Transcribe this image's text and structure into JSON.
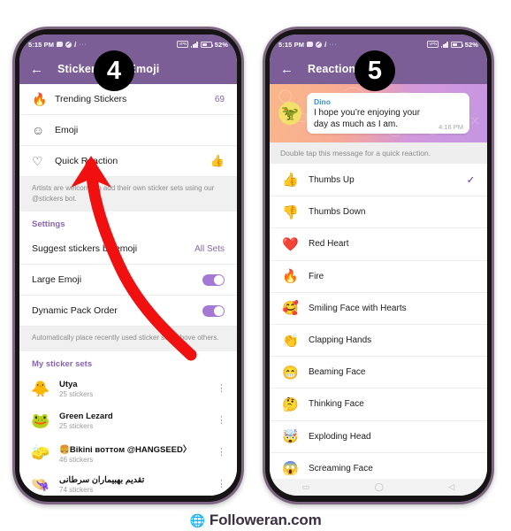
{
  "footer": {
    "site": "Followeran.com",
    "globe_icon": "globe-icon"
  },
  "phone_left": {
    "status_bar": {
      "time": "5:15 PM",
      "icons": [
        "message-bubble-icon",
        "mute-icon",
        "info-icon",
        "more-ellipsis-icon"
      ],
      "ellipsis": "···",
      "vpn_label": "VPN",
      "signal_icon": "signal-bars-icon",
      "battery_icon": "battery-icon",
      "battery_percent": "52%"
    },
    "app_bar": {
      "back_icon": "back-arrow-icon",
      "title": "Stickers and Emoji"
    },
    "step_badge": "4",
    "rows": [
      {
        "icon": "fire-icon",
        "label": "Trending Stickers",
        "value": "69"
      },
      {
        "icon": "smiley-icon",
        "label": "Emoji",
        "value": ""
      },
      {
        "icon": "heart-outline-icon",
        "label": "Quick Reaction",
        "emoji": "👍"
      }
    ],
    "artists_note": "Artists are welcome to add their own sticker sets using our @stickers bot.",
    "artists_note_link": "@stickers",
    "settings_header": "Settings",
    "settings_rows": [
      {
        "label": "Suggest stickers by emoji",
        "value": "All Sets",
        "type": "value"
      },
      {
        "label": "Large Emoji",
        "value": "on",
        "type": "toggle"
      },
      {
        "label": "Dynamic Pack Order",
        "value": "on",
        "type": "toggle"
      }
    ],
    "dynamic_note": "Automatically place recently used sticker sets above others.",
    "my_sets_header": "My sticker sets",
    "sticker_sets": [
      {
        "thumb": "🐥",
        "name": "Utya",
        "count": "25 stickers",
        "rtl": false
      },
      {
        "thumb": "🐸",
        "name": "Green Lezard",
        "count": "25 stickers",
        "rtl": false
      },
      {
        "thumb": "🧽",
        "name": "🍔Bikini вoттoм @HANGSEED〉",
        "count": "46 stickers",
        "rtl": false
      },
      {
        "thumb": "👒",
        "name": "تقدیم بهبیماران سرطانی",
        "count": "74 stickers",
        "rtl": true
      }
    ],
    "kebab_icon": "kebab-menu-icon"
  },
  "phone_right": {
    "status_bar": {
      "time": "5:15 PM",
      "ellipsis": "···",
      "vpn_label": "VPN",
      "battery_percent": "52%"
    },
    "app_bar": {
      "back_icon": "back-arrow-icon",
      "title": "Reactions"
    },
    "step_badge": "5",
    "message": {
      "avatar_emoji": "🦖",
      "sender": "Dino",
      "text": "I hope you’re enjoying your day as much as I am.",
      "time": "4:16 PM"
    },
    "hint": "Double tap this message for a quick reaction.",
    "reactions": [
      {
        "emoji": "👍",
        "label": "Thumbs Up",
        "selected": true
      },
      {
        "emoji": "👎",
        "label": "Thumbs Down",
        "selected": false
      },
      {
        "emoji": "❤️",
        "label": "Red Heart",
        "selected": false
      },
      {
        "emoji": "🔥",
        "label": "Fire",
        "selected": false
      },
      {
        "emoji": "🥰",
        "label": "Smiling Face with Hearts",
        "selected": false
      },
      {
        "emoji": "👏",
        "label": "Clapping Hands",
        "selected": false
      },
      {
        "emoji": "😁",
        "label": "Beaming Face",
        "selected": false
      },
      {
        "emoji": "🤔",
        "label": "Thinking Face",
        "selected": false
      },
      {
        "emoji": "🤯",
        "label": "Exploding Head",
        "selected": false
      },
      {
        "emoji": "😱",
        "label": "Screaming Face",
        "selected": false
      }
    ],
    "check_icon": "checkmark-icon",
    "navbar": {
      "back": "▭",
      "home": "◯",
      "recents": "◁"
    }
  },
  "annotation": {
    "arrow_color": "#f01010",
    "arrow_name": "red-arrow-annotation"
  }
}
